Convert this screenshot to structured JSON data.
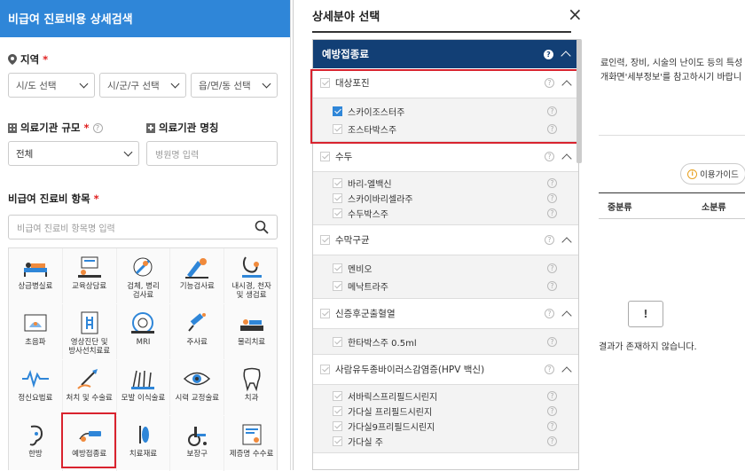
{
  "left": {
    "title": "비급여 진료비용 상세검색",
    "region_label": "지역",
    "region_selects": [
      "시/도 선택",
      "시/군/구 선택",
      "읍/면/동 선택"
    ],
    "size_label": "의료기관 규모",
    "size_value": "전체",
    "name_label": "의료기관 명칭",
    "name_placeholder": "병원명 입력",
    "item_label": "비급여 진료비 항목",
    "item_placeholder": "비급여 진료비 항목명 입력",
    "categories": [
      {
        "label": "상급병실료",
        "icon": "hospital-bed-icon"
      },
      {
        "label": "교육상담료",
        "icon": "consultation-icon"
      },
      {
        "label": "검체, 병리\n검사료",
        "icon": "microscope-icon"
      },
      {
        "label": "기능검사료",
        "icon": "function-test-icon"
      },
      {
        "label": "내시경, 천자\n및 생검료",
        "icon": "endoscope-icon"
      },
      {
        "label": "초음파",
        "icon": "ultrasound-icon"
      },
      {
        "label": "영상진단 및\n방사선치료료",
        "icon": "xray-icon"
      },
      {
        "label": "MRI",
        "icon": "mri-icon"
      },
      {
        "label": "주사료",
        "icon": "syringe-icon"
      },
      {
        "label": "물리치료",
        "icon": "physical-therapy-icon"
      },
      {
        "label": "정신요법료",
        "icon": "psychotherapy-icon"
      },
      {
        "label": "처치 및 수술료",
        "icon": "surgery-icon"
      },
      {
        "label": "모발 이식술료",
        "icon": "hair-transplant-icon"
      },
      {
        "label": "시력 교정술료",
        "icon": "eye-icon"
      },
      {
        "label": "치과",
        "icon": "tooth-icon"
      },
      {
        "label": "한방",
        "icon": "ear-acupuncture-icon"
      },
      {
        "label": "예방접종료",
        "icon": "vaccine-icon"
      },
      {
        "label": "치료재료",
        "icon": "treatment-material-icon"
      },
      {
        "label": "보장구",
        "icon": "wheelchair-icon"
      },
      {
        "label": "제증명 수수료",
        "icon": "certificate-icon"
      }
    ]
  },
  "modal": {
    "title": "상세분야 선택",
    "close": "×",
    "header": "예방접종료",
    "groups": [
      {
        "name": "대상포진",
        "items": [
          {
            "label": "스카이조스터주",
            "checked": true
          },
          {
            "label": "조스타박스주",
            "checked": false
          }
        ]
      },
      {
        "name": "수두",
        "items": [
          {
            "label": "바리-엘백신",
            "checked": false
          },
          {
            "label": "스카이바리셀라주",
            "checked": false
          },
          {
            "label": "수두박스주",
            "checked": false
          }
        ]
      },
      {
        "name": "수막구균",
        "items": [
          {
            "label": "멘비오",
            "checked": false
          },
          {
            "label": "메낙트라주",
            "checked": false
          }
        ]
      },
      {
        "name": "신증후군출혈열",
        "items": [
          {
            "label": "한타박스주 0.5ml",
            "checked": false
          }
        ]
      },
      {
        "name": "사람유두종바이러스감염증(HPV 백신)",
        "items": [
          {
            "label": "서바릭스프리필드시린지",
            "checked": false
          },
          {
            "label": "가다실 프리필드시린지",
            "checked": false
          },
          {
            "label": "가다실9프리필드시린지",
            "checked": false
          },
          {
            "label": "가다실 주",
            "checked": false
          }
        ]
      }
    ]
  },
  "right": {
    "notice1": "료인력, 장비, 시술의 난이도 등의 특성",
    "notice2": "개화면'세부정보'를 참고하시기 바랍니",
    "guide": "이용가이드",
    "col_mid": "중분류",
    "col_small": "소분류",
    "empty": "결과가 존재하지 않습니다.",
    "bubble": "!"
  }
}
